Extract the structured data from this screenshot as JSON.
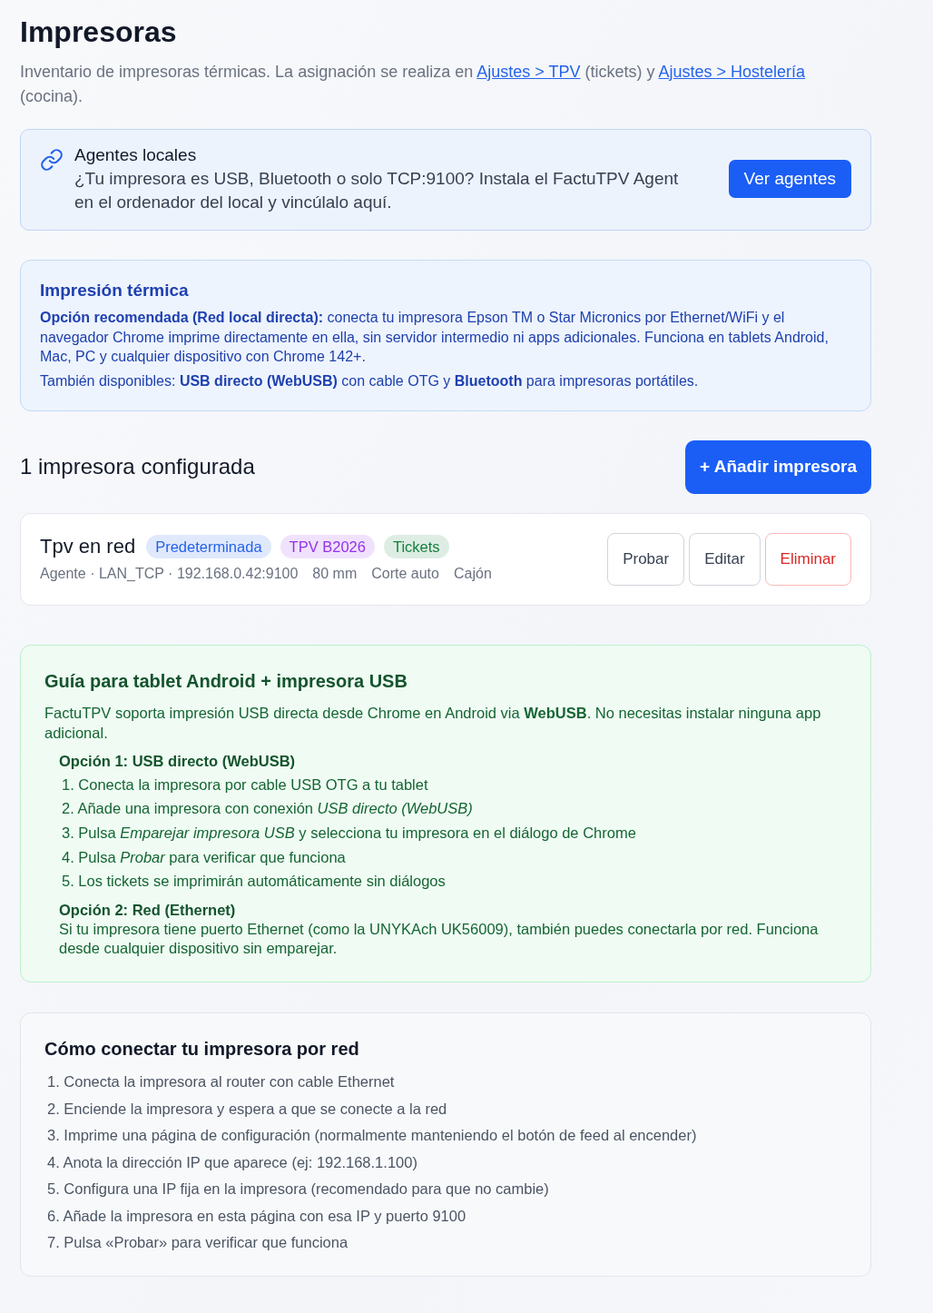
{
  "page": {
    "title": "Impresoras",
    "description": [
      {
        "kind": "text",
        "text": "Inventario de impresoras térmicas. La asignación se realiza en "
      },
      {
        "kind": "link",
        "text": "Ajustes > TPV"
      },
      {
        "kind": "text",
        "text": " (tickets) y "
      },
      {
        "kind": "link",
        "text": "Ajustes > Hostelería"
      },
      {
        "kind": "text",
        "text": " (cocina)."
      }
    ]
  },
  "agents_card": {
    "title": "Agentes locales",
    "text": "¿Tu impresora es USB, Bluetooth o solo TCP:9100? Instala el FactuTPV Agent en el ordenador del local y vincúlalo aquí.",
    "button": "Ver agentes"
  },
  "thermal_info": {
    "title": "Impresión térmica",
    "paragraphs": [
      "**Opción recomendada (Red local directa):** conecta tu impresora Epson TM o Star Micronics por Ethernet/WiFi y el navegador Chrome imprime directamente en ella, sin servidor intermedio ni apps adicionales. Funciona en tablets Android, Mac, PC y cualquier dispositivo con Chrome 142+.",
      "También disponibles: **USB directo (WebUSB)** con cable OTG y **Bluetooth** para impresoras portátiles."
    ]
  },
  "printers_header": {
    "count_label": "1 impresora configurada",
    "add_button": "+ Añadir impresora"
  },
  "printers": [
    {
      "name": "Tpv en red",
      "badges": [
        {
          "label": "Predeterminada",
          "color": "#2563eb"
        },
        {
          "label": "TPV B2026",
          "color": "#9333ea"
        },
        {
          "label": "Tickets",
          "color": "#15803d"
        }
      ],
      "details": [
        "Agente · LAN_TCP · 192.168.0.42:9100",
        "80 mm",
        "Corte auto",
        "Cajón"
      ],
      "actions": [
        {
          "label": "Probar",
          "kind": "default"
        },
        {
          "label": "Editar",
          "kind": "default"
        },
        {
          "label": "Eliminar",
          "kind": "danger"
        }
      ]
    }
  ],
  "android_guide": {
    "title": "Guía para tablet Android + impresora USB",
    "intro": "FactuTPV soporta impresión USB directa desde Chrome en Android via **WebUSB**. No necesitas instalar ninguna app adicional.",
    "options": [
      {
        "title": "Opción 1: USB directo (WebUSB)",
        "steps": [
          "1. Conecta la impresora por cable USB OTG a tu tablet",
          "2. Añade una impresora con conexión *USB directo (WebUSB)*",
          "3. Pulsa *Emparejar impresora USB* y selecciona tu impresora en el diálogo de Chrome",
          "4. Pulsa *Probar* para verificar que funciona",
          "5. Los tickets se imprimirán automáticamente sin diálogos"
        ]
      },
      {
        "title": "Opción 2: Red (Ethernet)",
        "text": "Si tu impresora tiene puerto Ethernet (como la UNYKAch UK56009), también puedes conectarla por red. Funciona desde cualquier dispositivo sin emparejar."
      }
    ]
  },
  "network_guide": {
    "title": "Cómo conectar tu impresora por red",
    "steps": [
      "1. Conecta la impresora al router con cable Ethernet",
      "2. Enciende la impresora y espera a que se conecte a la red",
      "3. Imprime una página de configuración (normalmente manteniendo el botón de feed al encender)",
      "4. Anota la dirección IP que aparece (ej: 192.168.1.100)",
      "5. Configura una IP fija en la impresora (recomendado para que no cambie)",
      "6. Añade la impresora en esta página con esa IP y puerto 9100",
      "7. Pulsa «Probar» para verificar que funciona"
    ]
  }
}
